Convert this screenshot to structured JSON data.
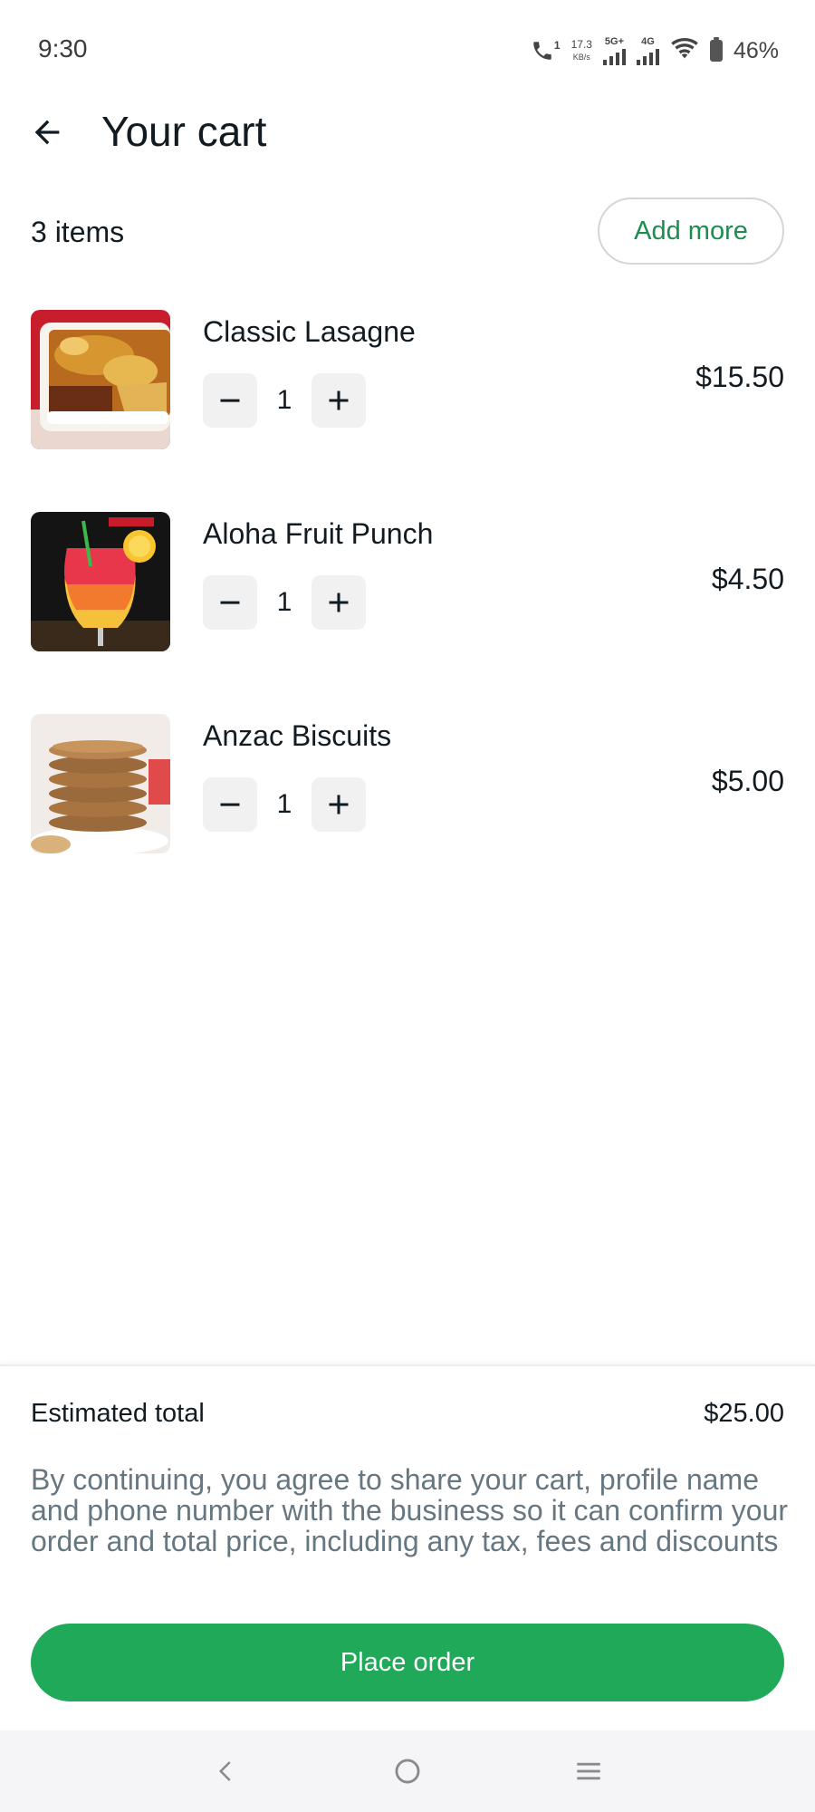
{
  "status_bar": {
    "time": "9:30",
    "call_badge": "1",
    "speed_value": "17.3",
    "speed_unit": "KB/s",
    "network_1": "5G+",
    "network_2": "4G",
    "battery": "46%"
  },
  "header": {
    "back_icon": "arrow-left-icon",
    "title": "Your cart"
  },
  "summary": {
    "items_count": "3 items",
    "add_more_label": "Add more"
  },
  "cart_items": [
    {
      "name": "Classic Lasagne",
      "quantity": "1",
      "price": "$15.50",
      "image": "lasagne-photo"
    },
    {
      "name": "Aloha Fruit Punch",
      "quantity": "1",
      "price": "$4.50",
      "image": "fruit-punch-photo"
    },
    {
      "name": "Anzac Biscuits",
      "quantity": "1",
      "price": "$5.00",
      "image": "biscuits-photo"
    }
  ],
  "footer": {
    "total_label": "Estimated total",
    "total_value": "$25.00",
    "disclaimer": "By continuing, you agree to share your cart, profile name and phone number with the business so it can confirm your order and total price, including any tax, fees and discounts",
    "place_order_label": "Place order"
  },
  "nav": {
    "back_icon": "nav-back-icon",
    "home_icon": "nav-home-icon",
    "menu_icon": "nav-menu-icon"
  },
  "colors": {
    "accent": "#21a95a",
    "accent_text": "#1c8d4e",
    "muted_text": "#667781"
  }
}
